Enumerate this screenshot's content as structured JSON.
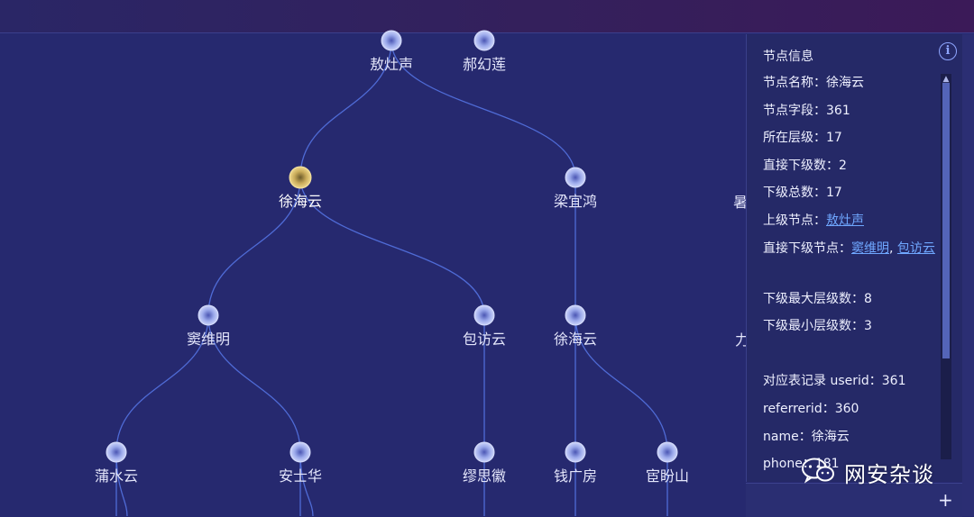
{
  "tree": {
    "nodes": [
      {
        "id": "n1",
        "label": "敖灶声",
        "selected": false
      },
      {
        "id": "n2",
        "label": "郝幻莲",
        "selected": false
      },
      {
        "id": "n3",
        "label": "徐海云",
        "selected": true
      },
      {
        "id": "n4",
        "label": "梁宜鸿",
        "selected": false
      },
      {
        "id": "n5",
        "label": "窦维明",
        "selected": false
      },
      {
        "id": "n6",
        "label": "包访云",
        "selected": false
      },
      {
        "id": "n7",
        "label": "徐海云",
        "selected": false
      },
      {
        "id": "n8",
        "label": "蒲水云",
        "selected": false
      },
      {
        "id": "n9",
        "label": "安士华",
        "selected": false
      },
      {
        "id": "n10",
        "label": "缪思徽",
        "selected": false
      },
      {
        "id": "n11",
        "label": "钱广房",
        "selected": false
      },
      {
        "id": "n12",
        "label": "宦盼山",
        "selected": false
      },
      {
        "id": "c1",
        "label": "暑",
        "selected": false
      },
      {
        "id": "c2",
        "label": "力",
        "selected": false
      }
    ],
    "links": [
      [
        "n1",
        "n3"
      ],
      [
        "n1",
        "n4"
      ],
      [
        "n3",
        "n5"
      ],
      [
        "n3",
        "n6"
      ],
      [
        "n4",
        "n7"
      ],
      [
        "n5",
        "n8"
      ],
      [
        "n5",
        "n9"
      ],
      [
        "n6",
        "n10"
      ],
      [
        "n7",
        "n11"
      ],
      [
        "n7",
        "n12"
      ]
    ]
  },
  "panel": {
    "title": "节点信息",
    "info_icon": "info-icon",
    "rows": {
      "name": "节点名称：徐海云",
      "field": "节点字段：361",
      "level": "所在层级：17",
      "direct_children_count": "直接下级数：2",
      "total_children": "下级总数：17",
      "parent_label": "上级节点：",
      "parent_link": "敖灶声",
      "children_label": "直接下级节点：",
      "child_link_1": "窦维明",
      "child_sep": ", ",
      "child_link_2": "包访云",
      "max_depth": "下级最大层级数：8",
      "min_depth": "下级最小层级数：3",
      "userid": "对应表记录 userid：361",
      "referrerid": "referrerid：360",
      "record_name": "name：徐海云",
      "phone": "phone：181"
    }
  },
  "watermark": {
    "text": "网安杂谈",
    "icon": "wechat-icon"
  },
  "bottom_bar": {
    "plus_label": "+"
  },
  "colors": {
    "background": "#26296f",
    "link_line": "#4f6bd6",
    "node_fill": "#b9c3f2",
    "selected_fill": "#d9c06f",
    "link_text": "#6fa7ff"
  }
}
